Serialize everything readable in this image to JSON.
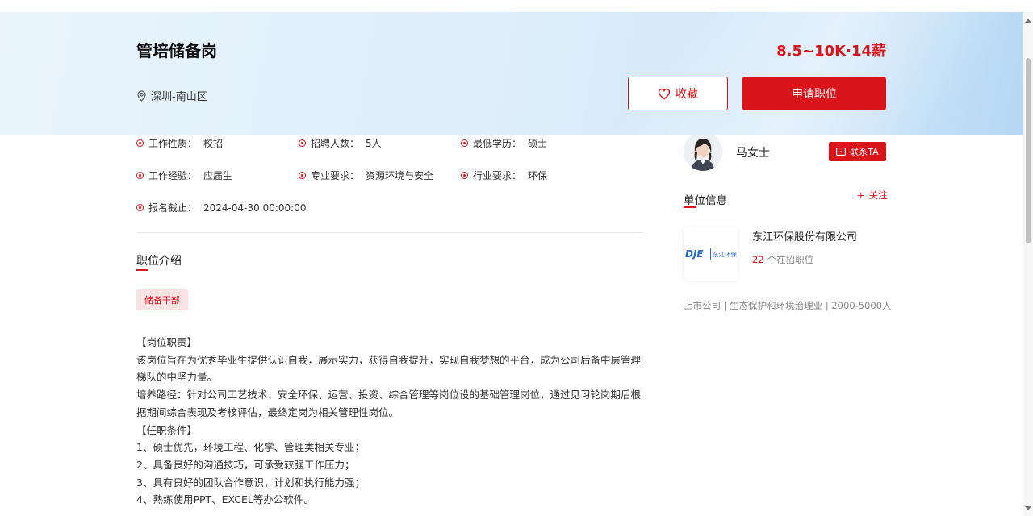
{
  "header": {
    "title": "管培储备岗",
    "salary": "8.5~10K·14薪",
    "location": "深圳-南山区",
    "favorite_label": "收藏",
    "apply_label": "申请职位"
  },
  "attributes": [
    {
      "key": "工作性质：",
      "value": "校招"
    },
    {
      "key": "招聘人数：",
      "value": "5人"
    },
    {
      "key": "最低学历：",
      "value": "硕士"
    },
    {
      "key": "工作经验：",
      "value": "应届生"
    },
    {
      "key": "专业要求：",
      "value": "资源环境与安全"
    },
    {
      "key": "行业要求：",
      "value": "环保"
    },
    {
      "key": "报名截止：",
      "value": "2024-04-30 00:00:00"
    }
  ],
  "intro": {
    "title": "职位介绍",
    "tag": "储备干部",
    "lines": [
      "【岗位职责】",
      "该岗位旨在为优秀毕业生提供认识自我，展示实力，获得自我提升，实现自我梦想的平台，成为公司后备中层管理",
      "梯队的中坚力量。",
      "培养路径：针对公司工艺技术、安全环保、运营、投资、综合管理等岗位设的基础管理岗位，通过见习轮岗期后根",
      "据期间综合表现及考核评估，最终定岗为相关管理性岗位。",
      "【任职条件】",
      "1、硕士优先，环境工程、化学、管理类相关专业；",
      "2、具备良好的沟通技巧，可承受较强工作压力；",
      "3、具有良好的团队合作意识，计划和执行能力强；",
      "4、熟练使用PPT、EXCEL等办公软件。"
    ]
  },
  "contact": {
    "name": "马女士",
    "button_label": "联系TA"
  },
  "company": {
    "section_title": "单位信息",
    "follow_label": "关注",
    "name": "东江环保股份有限公司",
    "logo_text": "东江环保",
    "logo_mark": "DJE",
    "job_count": "22",
    "job_count_suffix": "个在招职位",
    "meta": "上市公司 | 生态保护和环境治理业 | 2000-5000人"
  },
  "colors": {
    "accent": "#d9141b"
  }
}
